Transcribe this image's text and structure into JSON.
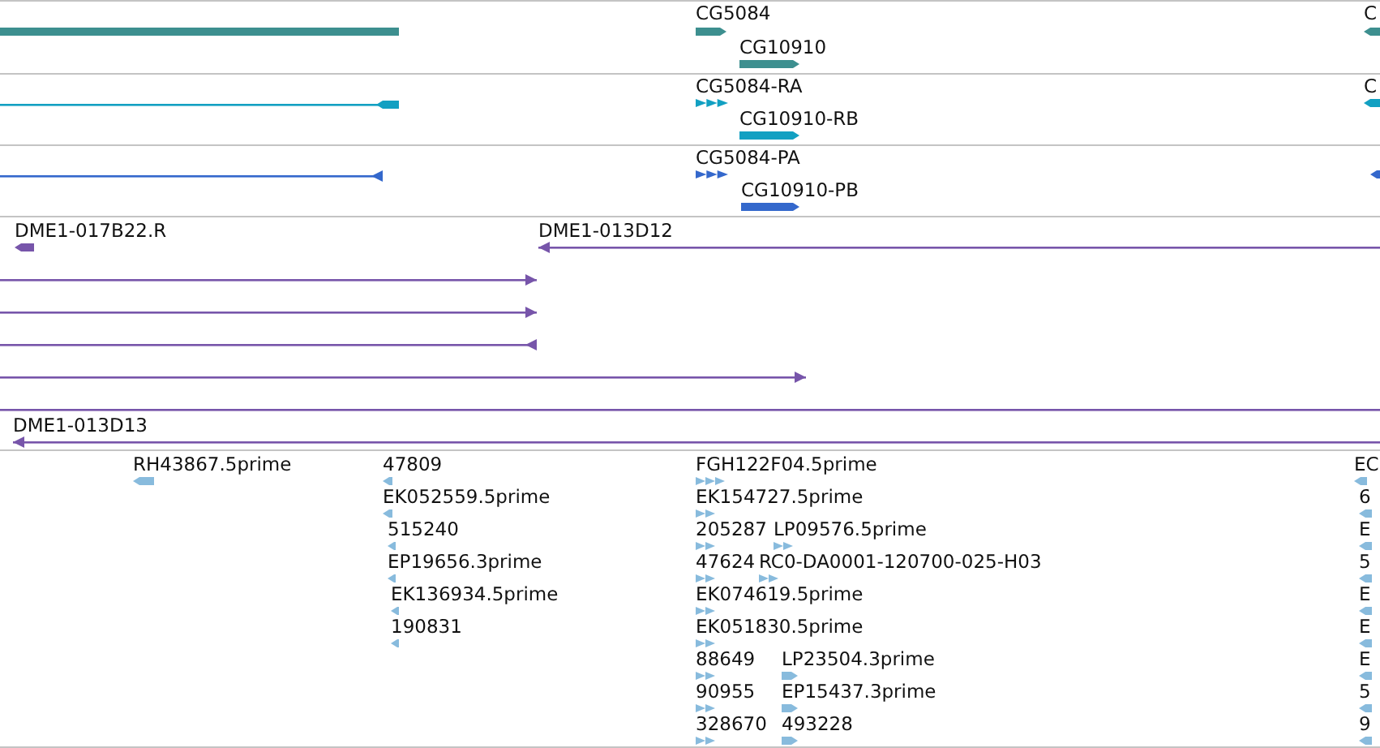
{
  "tracks": [
    {
      "color": "#3d8f8f",
      "features": [
        {
          "kind": "bar"
        },
        {
          "label": "CG5084",
          "kind": "bar",
          "forward": true
        },
        {
          "label": "CG10910",
          "kind": "bar",
          "forward": true
        },
        {
          "label": "C",
          "kind": "bar",
          "forward": false
        }
      ]
    },
    {
      "color": "#12a0c2",
      "features": [
        {
          "kind": "transcript",
          "forward": false
        },
        {
          "label": "CG5084-RA",
          "kind": "chevrons",
          "forward": true
        },
        {
          "label": "CG10910-RB",
          "kind": "bar",
          "forward": true
        },
        {
          "label": "C",
          "kind": "bar",
          "forward": false
        }
      ]
    },
    {
      "color": "#3468cc",
      "features": [
        {
          "kind": "line",
          "forward": false
        },
        {
          "label": "CG5084-PA",
          "kind": "chevrons",
          "forward": true
        },
        {
          "label": "CG10910-PB",
          "kind": "bar",
          "forward": true
        },
        {
          "kind": "bar",
          "forward": false
        }
      ]
    },
    {
      "color": "#7755aa",
      "features": [
        {
          "label": "DME1-017B22.R",
          "kind": "bar",
          "forward": false
        },
        {
          "label": "DME1-013D12",
          "kind": "line",
          "forward": false
        },
        {
          "kind": "line",
          "forward": true
        },
        {
          "kind": "line",
          "forward": true
        },
        {
          "kind": "line",
          "forward": false
        },
        {
          "kind": "line",
          "forward": true
        },
        {
          "kind": "line"
        },
        {
          "label": "DME1-013D13",
          "kind": "line",
          "forward": false
        }
      ]
    },
    {
      "color": "#88bbdd",
      "features": [
        {
          "label": "RH43867.5prime",
          "kind": "bar",
          "forward": false
        },
        {
          "label": "47809",
          "kind": "bar",
          "forward": false
        },
        {
          "label": "EK052559.5prime",
          "kind": "bar",
          "forward": false
        },
        {
          "label": "515240",
          "kind": "bar",
          "forward": false
        },
        {
          "label": "EP19656.3prime",
          "kind": "bar",
          "forward": false
        },
        {
          "label": "EK136934.5prime",
          "kind": "bar",
          "forward": false
        },
        {
          "label": "190831",
          "kind": "bar",
          "forward": false
        },
        {
          "label": "FGH122F04.5prime",
          "kind": "chevrons",
          "forward": true
        },
        {
          "label": "EK154727.5prime",
          "kind": "chevrons",
          "forward": true
        },
        {
          "label": "205287",
          "kind": "chevrons",
          "forward": true
        },
        {
          "label": "LP09576.5prime",
          "kind": "chevrons",
          "forward": true
        },
        {
          "label": "47624",
          "kind": "chevrons",
          "forward": true
        },
        {
          "label": "RC0-DA0001-120700-025-H03",
          "kind": "chevrons",
          "forward": true
        },
        {
          "label": "EK074619.5prime",
          "kind": "chevrons",
          "forward": true
        },
        {
          "label": "EK051830.5prime",
          "kind": "chevrons",
          "forward": true
        },
        {
          "label": "88649",
          "kind": "chevrons",
          "forward": true
        },
        {
          "label": "LP23504.3prime",
          "kind": "bar",
          "forward": true
        },
        {
          "label": "90955",
          "kind": "chevrons",
          "forward": true
        },
        {
          "label": "EP15437.3prime",
          "kind": "bar",
          "forward": true
        },
        {
          "label": "328670",
          "kind": "chevrons",
          "forward": true
        },
        {
          "label": "493228",
          "kind": "bar",
          "forward": true
        },
        {
          "label": "EC",
          "kind": "bar",
          "forward": false
        },
        {
          "label": "6",
          "kind": "bar",
          "forward": false
        },
        {
          "label": "E",
          "kind": "bar",
          "forward": false
        },
        {
          "label": "5",
          "kind": "bar",
          "forward": false
        },
        {
          "label": "E",
          "kind": "bar",
          "forward": false
        },
        {
          "label": "E",
          "kind": "bar",
          "forward": false
        },
        {
          "label": "E",
          "kind": "bar",
          "forward": false
        },
        {
          "label": "5",
          "kind": "bar",
          "forward": false
        },
        {
          "label": "9",
          "kind": "bar",
          "forward": false
        }
      ]
    }
  ]
}
